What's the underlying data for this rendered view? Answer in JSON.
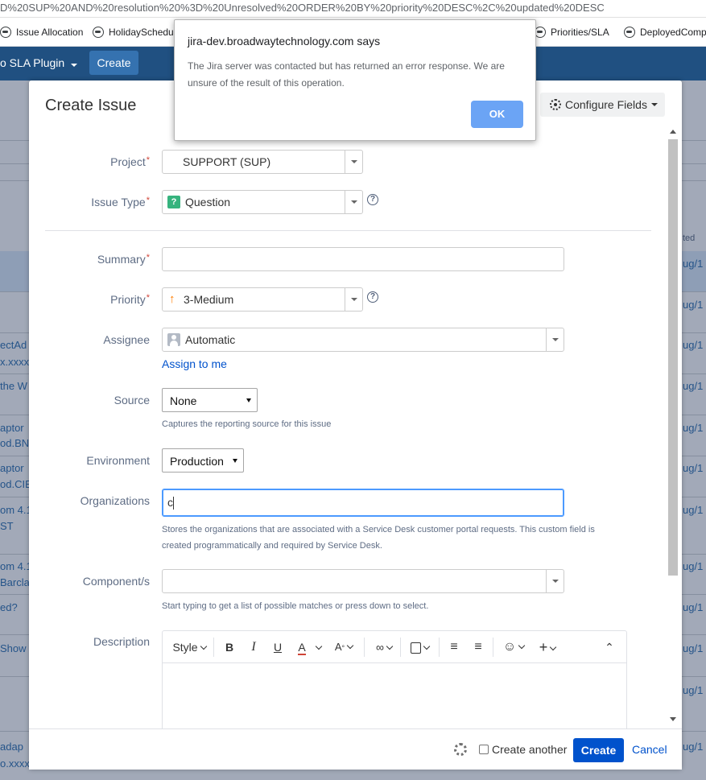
{
  "browser": {
    "url": "D%20SUP%20AND%20resolution%20%3D%20Unresolved%20ORDER%20BY%20priority%20DESC%2C%20updated%20DESC",
    "bookmarks": [
      {
        "label": "Issue Allocation",
        "icon": "globe-icon"
      },
      {
        "label": "HolidaySchedu",
        "icon": "globe-icon"
      },
      {
        "label": "Priorities/SLA",
        "icon": "globe-icon"
      },
      {
        "label": "DeployedComp",
        "icon": "globe-icon"
      }
    ]
  },
  "header": {
    "plugin_menu": "o SLA Plugin",
    "create_label": "Create"
  },
  "background": {
    "left_texts": [
      "ectAd",
      "x.xxxxx",
      "the W",
      "aptor",
      "od.BNY",
      "aptor",
      "od.CIB",
      "om 4.1",
      "ST",
      "om 4.1",
      "Barcla",
      "ed?",
      "Show",
      "adap",
      "o.xxxx"
    ],
    "right_header": "ted",
    "right_texts": [
      "ug/1",
      "ug/1",
      "ug/1",
      "ug/1",
      "ug/1",
      "ug/1",
      "ug/1",
      "ug/1",
      "ug/1",
      "ug/1",
      "ug/1",
      "ug/1"
    ]
  },
  "dialog": {
    "title": "Create Issue",
    "configure_label": "Configure Fields",
    "fields": {
      "project": {
        "label": "Project",
        "value": "SUPPORT (SUP)"
      },
      "issue_type": {
        "label": "Issue Type",
        "value": "Question"
      },
      "summary": {
        "label": "Summary",
        "value": ""
      },
      "priority": {
        "label": "Priority",
        "value": "3-Medium",
        "color": "#ff7d00"
      },
      "assignee": {
        "label": "Assignee",
        "value": "Automatic",
        "assign_link": "Assign to me"
      },
      "source": {
        "label": "Source",
        "value": "None",
        "description": "Captures the reporting source for this issue"
      },
      "environment": {
        "label": "Environment",
        "value": "Production"
      },
      "organizations": {
        "label": "Organizations",
        "value": "c",
        "description_line1": "Stores the organizations that are associated with a Service Desk customer portal requests. This custom field is",
        "description_line2": "created programmatically and required by Service Desk."
      },
      "components": {
        "label": "Component/s",
        "value": "",
        "description": "Start typing to get a list of possible matches or press down to select."
      },
      "description": {
        "label": "Description",
        "toolbar_style": "Style"
      }
    },
    "footer": {
      "create_another": "Create another",
      "create": "Create",
      "cancel": "Cancel"
    }
  },
  "alert": {
    "title": "jira-dev.broadwaytechnology.com says",
    "message": "The Jira server was contacted but has returned an error response. We are unsure of the result of this operation.",
    "ok": "OK"
  },
  "colors": {
    "header_bg": "#205081",
    "primary": "#0052cc",
    "alert_ok": "#6ba4f5",
    "required": "#d04437"
  }
}
